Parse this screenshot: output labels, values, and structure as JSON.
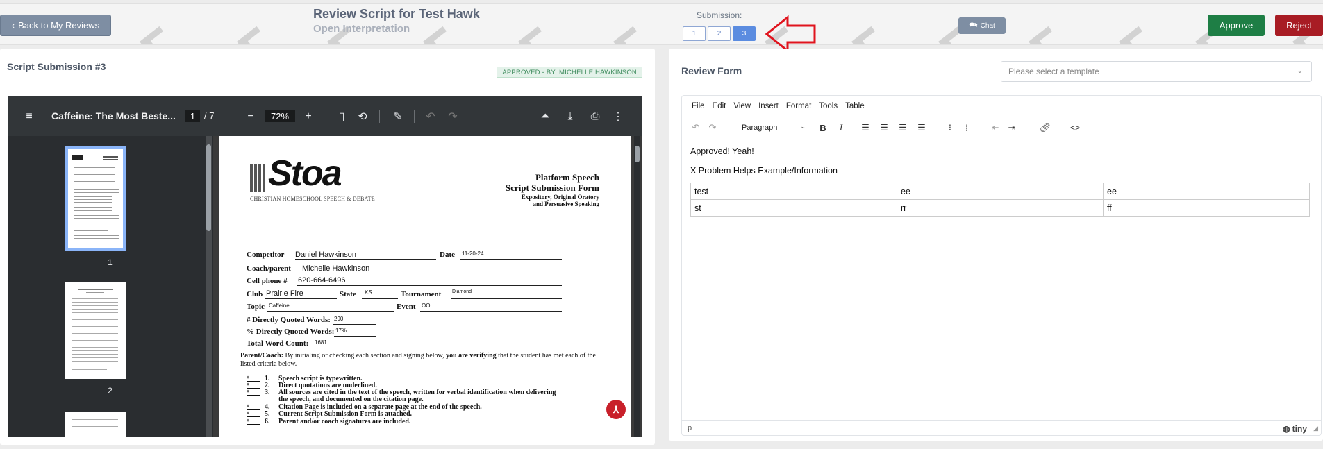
{
  "header": {
    "back_label": "Back to My Reviews",
    "title": "Review Script for Test Hawk",
    "subtitle": "Open Interpretation",
    "submission_label": "Submission:",
    "submissions": [
      "1",
      "2",
      "3"
    ],
    "active_submission": "3",
    "chat_label": "Chat",
    "approve_label": "Approve",
    "reject_label": "Reject"
  },
  "left_panel": {
    "title": "Script Submission #3",
    "status_badge": "APPROVED - BY: MICHELLE HAWKINSON",
    "viewer": {
      "doc_title": "Caffeine: The Most Beste...",
      "page_current": "1",
      "page_total": "/ 7",
      "zoom": "72%",
      "thumbnails": [
        {
          "label": "1",
          "selected": true
        },
        {
          "label": "2",
          "selected": false
        }
      ]
    },
    "document": {
      "logo_text": "Stoa",
      "logo_sub": "CHRISTIAN HOMESCHOOL SPEECH & DEBATE",
      "heading1": "Platform Speech",
      "heading2": "Script Submission Form",
      "heading3": "Expository, Original Oratory",
      "heading4": "and Persuasive Speaking",
      "competitor_label": "Competitor",
      "competitor_value": "Daniel Hawkinson",
      "date_label": "Date",
      "date_value": "11-20-24",
      "coach_label": "Coach/parent",
      "coach_value": "Michelle Hawkinson",
      "cell_label": "Cell phone #",
      "cell_value": "620-664-6496",
      "club_label": "Club",
      "club_value": "Prairie Fire",
      "state_label": "State",
      "state_value": "KS",
      "tournament_label": "Tournament",
      "tournament_value": "Diamond",
      "topic_label": "Topic",
      "topic_value": "Caffeine",
      "event_label": "Event",
      "event_value": "OO",
      "quoted_words_label": "# Directly Quoted Words:",
      "quoted_words_value": "290",
      "quoted_pct_label": "% Directly Quoted Words:",
      "quoted_pct_value": "17%",
      "word_count_label": "Total Word Count:",
      "word_count_value": "1681",
      "parent_lead": "Parent/Coach:",
      "parent_text": " By initialing or checking each section and signing below, ",
      "parent_bold": "you are verifying",
      "parent_tail": " that the student has met each of the listed criteria below.",
      "criteria": [
        {
          "check": "x",
          "num": "1.",
          "text": "Speech script is typewritten."
        },
        {
          "check": "x",
          "num": "2.",
          "text": "Direct quotations are underlined."
        },
        {
          "check": "x",
          "num": "3.",
          "text": "All sources are cited in the text of the speech, written for verbal identification when delivering"
        },
        {
          "check": "",
          "num": "",
          "text": "the speech, and documented on the citation page."
        },
        {
          "check": "x",
          "num": "4.",
          "text": "Citation Page is included on a separate page at the end of the speech."
        },
        {
          "check": "x",
          "num": "5.",
          "text": "Current Script Submission Form is attached."
        },
        {
          "check": "x",
          "num": "6.",
          "text": "Parent and/or coach signatures are included."
        }
      ]
    }
  },
  "right_panel": {
    "title": "Review Form",
    "template_placeholder": "Please select a template",
    "editor": {
      "menu": [
        "File",
        "Edit",
        "View",
        "Insert",
        "Format",
        "Tools",
        "Table"
      ],
      "block_format": "Paragraph",
      "paragraphs": [
        "Approved! Yeah!",
        "X Problem Helps Example/Information"
      ],
      "table": [
        [
          "test",
          "ee",
          "ee"
        ],
        [
          "st",
          "rr",
          "ff"
        ]
      ],
      "status_path": "p",
      "brand": "tiny"
    }
  },
  "colors": {
    "approve": "#1e7e45",
    "reject": "#a81c24",
    "active_submission": "#5b8ce0",
    "back_button": "#7e8ea3",
    "annotation_arrow": "#e0141e"
  }
}
